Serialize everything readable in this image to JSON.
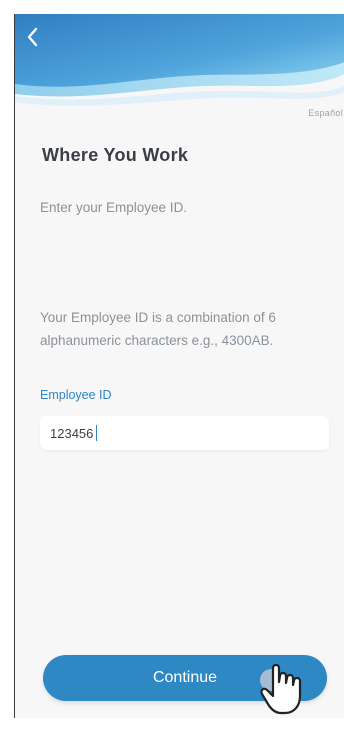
{
  "header": {
    "back_icon": "chevron-left-icon",
    "language_link": "Español"
  },
  "page": {
    "title": "Where You Work",
    "subtitle": "Enter your Employee ID.",
    "helper_text": "Your Employee ID is a combination of 6 alphanumeric characters e.g., 4300AB."
  },
  "form": {
    "employee_id_label": "Employee ID",
    "employee_id_value": "123456"
  },
  "actions": {
    "continue_label": "Continue"
  },
  "colors": {
    "accent": "#2e88c4",
    "wave_dark": "#2f7fc1",
    "wave_light": "#8fd3f0"
  }
}
